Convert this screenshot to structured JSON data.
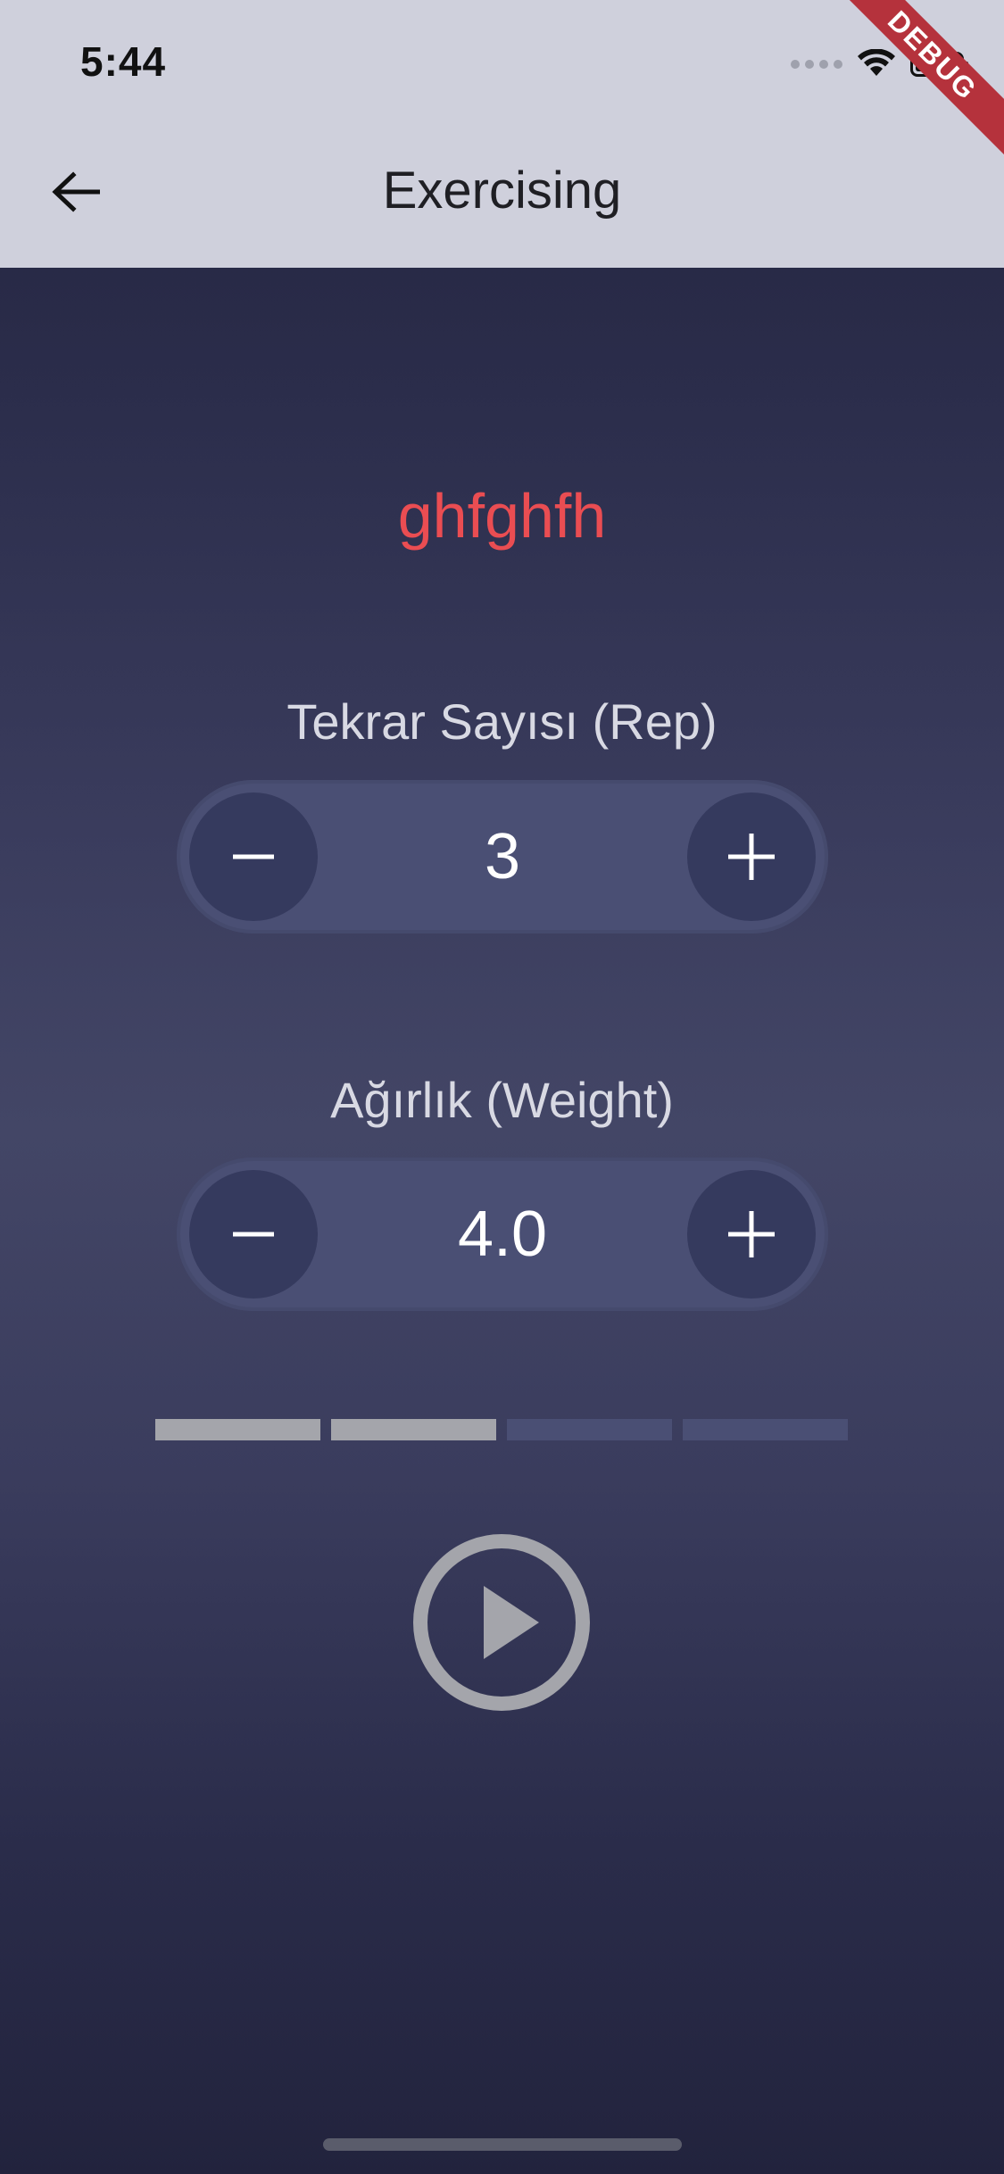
{
  "status_bar": {
    "time": "5:44"
  },
  "debug_banner": "DEBUG",
  "app_bar": {
    "title": "Exercising",
    "back_icon": "arrow-left-icon"
  },
  "exercise": {
    "name": "ghfghfh",
    "name_color": "#ea4d52"
  },
  "reps": {
    "label": "Tekrar Sayısı (Rep)",
    "value": "3"
  },
  "weight": {
    "label": "Ağırlık (Weight)",
    "value": "4.0"
  },
  "sets_progress": {
    "total": 4,
    "completed": 2,
    "completed_color": "#a4a5ab",
    "pending_color": "#4a4f74"
  },
  "play_icon": "play-circle-icon",
  "colors": {
    "accent": "#ea4d52",
    "app_bar": "#cfd0dc",
    "stepper_track": "#4a4f74",
    "stepper_button": "#353a5e"
  }
}
